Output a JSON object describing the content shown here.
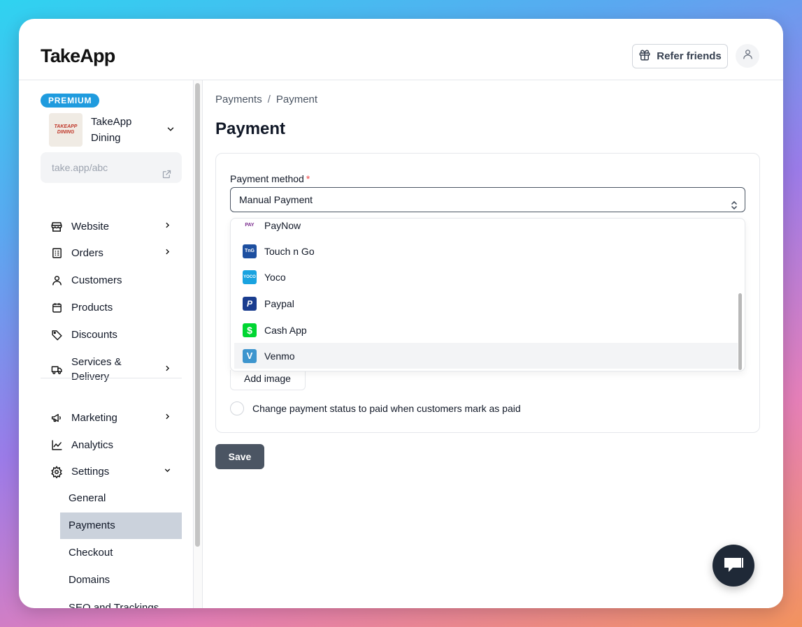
{
  "app": {
    "logo": "TakeApp",
    "refer_label": "Refer friends"
  },
  "sidebar": {
    "badge": "PREMIUM",
    "store_name": "TakeApp Dining",
    "store_logo_text": [
      "TAKEAPP",
      "DINING"
    ],
    "store_url": "take.app/abc",
    "items": [
      {
        "label": "Website",
        "icon": "store-icon",
        "chevron": "right"
      },
      {
        "label": "Orders",
        "icon": "receipt-icon",
        "chevron": "right"
      },
      {
        "label": "Customers",
        "icon": "user-icon"
      },
      {
        "label": "Products",
        "icon": "calendar-box-icon"
      },
      {
        "label": "Discounts",
        "icon": "tag-icon"
      },
      {
        "label": "Services & Delivery",
        "icon": "truck-icon",
        "chevron": "right"
      },
      {
        "label": "Marketing",
        "icon": "megaphone-icon",
        "chevron": "right"
      },
      {
        "label": "Analytics",
        "icon": "chart-line-icon"
      },
      {
        "label": "Settings",
        "icon": "gear-icon",
        "chevron": "down"
      }
    ],
    "settings_sub": [
      "General",
      "Payments",
      "Checkout",
      "Domains",
      "SEO and Trackings"
    ],
    "active_sub": "Payments"
  },
  "main": {
    "breadcrumb": [
      "Payments",
      "Payment"
    ],
    "breadcrumb_sep": "/",
    "title": "Payment",
    "payment_method_label": "Payment method",
    "required_mark": "*",
    "selected_method": "Manual Payment",
    "options": [
      {
        "label": "PayNow",
        "color": "#7b2d8e",
        "glyph": "PAY"
      },
      {
        "label": "Touch n Go",
        "color": "#1d4fa0",
        "glyph": "TnG"
      },
      {
        "label": "Yoco",
        "color": "#19a3e0",
        "glyph": "YOCO"
      },
      {
        "label": "Paypal",
        "color": "#1a3d8f",
        "glyph": "P"
      },
      {
        "label": "Cash App",
        "color": "#00d632",
        "glyph": "$"
      },
      {
        "label": "Venmo",
        "color": "#3d95ce",
        "glyph": "V"
      }
    ],
    "hovered_option": "Venmo",
    "add_image_label": "Add image",
    "checkbox_label": "Change payment status to paid when customers mark as paid",
    "checkbox_checked": false,
    "save_label": "Save"
  }
}
